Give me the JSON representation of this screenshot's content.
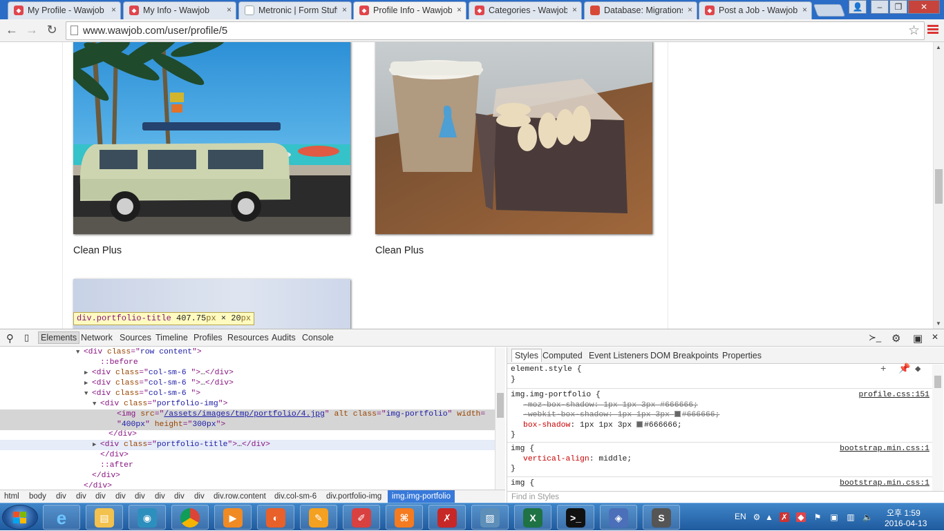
{
  "browser": {
    "tabs": [
      {
        "title": "My Profile - Wawjob",
        "favicon": "wawjob-icon",
        "active": false
      },
      {
        "title": "My Info - Wawjob",
        "favicon": "wawjob-icon",
        "active": false
      },
      {
        "title": "Metronic | Form Stuff",
        "favicon": "document-icon",
        "active": false
      },
      {
        "title": "Profile Info - Wawjob",
        "favicon": "wawjob-icon",
        "active": true
      },
      {
        "title": "Categories - Wawjob",
        "favicon": "wawjob-icon",
        "active": false
      },
      {
        "title": "Database: Migrations",
        "favicon": "database-icon",
        "active": false
      },
      {
        "title": "Post a Job - Wawjob",
        "favicon": "wawjob-icon",
        "active": false
      }
    ],
    "tab_close": "×",
    "url": "www.wawjob.com/user/profile/5",
    "back": "←",
    "forward": "→",
    "reload": "↻",
    "star": "☆",
    "window": {
      "user": "👤",
      "minimize": "–",
      "restore": "❐",
      "close": "✕"
    }
  },
  "page": {
    "portfolio": [
      {
        "title": "Clean Plus",
        "image": "vw-van-beach-photo"
      },
      {
        "title": "Clean Plus",
        "image": "coffee-macarons-photo"
      },
      {
        "title": "",
        "image": "sky-photo"
      }
    ],
    "tooltip": {
      "selector": "div.portfolio-title",
      "size": "407.75",
      "unit1": "px",
      "times": " × ",
      "height": "20",
      "unit2": "px"
    }
  },
  "devtools": {
    "tabs": [
      "Elements",
      "Network",
      "Sources",
      "Timeline",
      "Profiles",
      "Resources",
      "Audits",
      "Console"
    ],
    "active_tab": "Elements",
    "dom": [
      {
        "tri": "▼",
        "parts": [
          [
            "tg",
            "<div "
          ],
          [
            "at",
            "class"
          ],
          [
            "tg",
            "=\""
          ],
          [
            "av",
            "row content"
          ],
          [
            "tg",
            "\">"
          ]
        ]
      },
      {
        "tri": "",
        "parts": [
          [
            "ps",
            "::before"
          ]
        ]
      },
      {
        "tri": "▶",
        "parts": [
          [
            "tg",
            "<div "
          ],
          [
            "at",
            "class"
          ],
          [
            "tg",
            "=\""
          ],
          [
            "av",
            "col-sm-6 "
          ],
          [
            "tg",
            "\">"
          ],
          [
            "tx",
            "…"
          ],
          [
            "tg",
            "</div>"
          ]
        ]
      },
      {
        "tri": "▶",
        "parts": [
          [
            "tg",
            "<div "
          ],
          [
            "at",
            "class"
          ],
          [
            "tg",
            "=\""
          ],
          [
            "av",
            "col-sm-6 "
          ],
          [
            "tg",
            "\">"
          ],
          [
            "tx",
            "…"
          ],
          [
            "tg",
            "</div>"
          ]
        ]
      },
      {
        "tri": "▼",
        "parts": [
          [
            "tg",
            "<div "
          ],
          [
            "at",
            "class"
          ],
          [
            "tg",
            "=\""
          ],
          [
            "av",
            "col-sm-6 "
          ],
          [
            "tg",
            "\">"
          ]
        ]
      },
      {
        "tri": "▼",
        "parts": [
          [
            "tg",
            "<div "
          ],
          [
            "at",
            "class"
          ],
          [
            "tg",
            "=\""
          ],
          [
            "av",
            "portfolio-img"
          ],
          [
            "tg",
            "\">"
          ]
        ]
      },
      {
        "tri": "",
        "parts": [
          [
            "tg",
            "<img "
          ],
          [
            "at",
            "src"
          ],
          [
            "tg",
            "=\""
          ],
          [
            "avl",
            "/assets/images/tmp/portfolio/4.jpg"
          ],
          [
            "tg",
            "\" "
          ],
          [
            "at",
            "alt class"
          ],
          [
            "tg",
            "=\""
          ],
          [
            "av",
            "img-portfolio"
          ],
          [
            "tg",
            "\" "
          ],
          [
            "at",
            "width"
          ],
          [
            "tg",
            "="
          ]
        ]
      },
      {
        "tri": "",
        "parts": [
          [
            "tg",
            "\""
          ],
          [
            "av",
            "400px"
          ],
          [
            "tg",
            "\" "
          ],
          [
            "at",
            "height"
          ],
          [
            "tg",
            "=\""
          ],
          [
            "av",
            "300px"
          ],
          [
            "tg",
            "\">"
          ]
        ]
      },
      {
        "tri": "",
        "parts": [
          [
            "tg",
            "</div>"
          ]
        ]
      },
      {
        "tri": "▶",
        "parts": [
          [
            "tg",
            "<div "
          ],
          [
            "at",
            "class"
          ],
          [
            "tg",
            "=\""
          ],
          [
            "av",
            "portfolio-title"
          ],
          [
            "tg",
            "\">"
          ],
          [
            "tx",
            "…"
          ],
          [
            "tg",
            "</div>"
          ]
        ]
      },
      {
        "tri": "",
        "parts": [
          [
            "tg",
            "</div>"
          ]
        ]
      },
      {
        "tri": "",
        "parts": [
          [
            "ps",
            "::after"
          ]
        ]
      },
      {
        "tri": "",
        "parts": [
          [
            "tg",
            "</div>"
          ]
        ]
      },
      {
        "tri": "",
        "parts": [
          [
            "tg",
            "</div>"
          ]
        ]
      }
    ],
    "breadcrumbs": [
      "html",
      "body",
      "div",
      "div",
      "div",
      "div",
      "div",
      "div",
      "div",
      "div",
      "div.row.content",
      "div.col-sm-6",
      "div.portfolio-img",
      "img.img-portfolio"
    ],
    "styles_tabs": [
      "Styles",
      "Computed",
      "Event Listeners",
      "DOM Breakpoints",
      "Properties"
    ],
    "element_style": "element.style {",
    "close_brace": "}",
    "rule1": {
      "selector": "img.img-portfolio {",
      "source": "profile.css:151",
      "decls": [
        {
          "prop": "-moz-box-shadow",
          "value": "1px 1px 3px #666666;",
          "struck": true,
          "swatch": false
        },
        {
          "prop": "-webkit-box-shadow",
          "value": "1px 1px 3px",
          "value2": "#666666;",
          "struck": true,
          "swatch": true
        },
        {
          "prop": "box-shadow",
          "value": "1px 1px 3px",
          "value2": "#666666;",
          "struck": false,
          "swatch": true
        }
      ]
    },
    "rule2": {
      "selector": "img {",
      "source": "bootstrap.min.css:1",
      "prop": "vertical-align",
      "value": "middle;"
    },
    "rule3": {
      "selector": "img {",
      "source": "bootstrap.min.css:1"
    },
    "find_placeholder": "Find in Styles"
  },
  "taskbar": {
    "apps": [
      "ie-icon",
      "explorer-icon",
      "media-player-icon",
      "chrome-icon",
      "video-icon",
      "firefox-icon",
      "xampp-tools-icon",
      "eraser-icon",
      "xampp-icon",
      "filezilla-icon",
      "photo-viewer-icon",
      "excel-icon",
      "cmd-icon",
      "dolphin-icon",
      "sublime-icon"
    ],
    "lang": "EN",
    "time": "오후 1:59",
    "date": "2016-04-13"
  }
}
